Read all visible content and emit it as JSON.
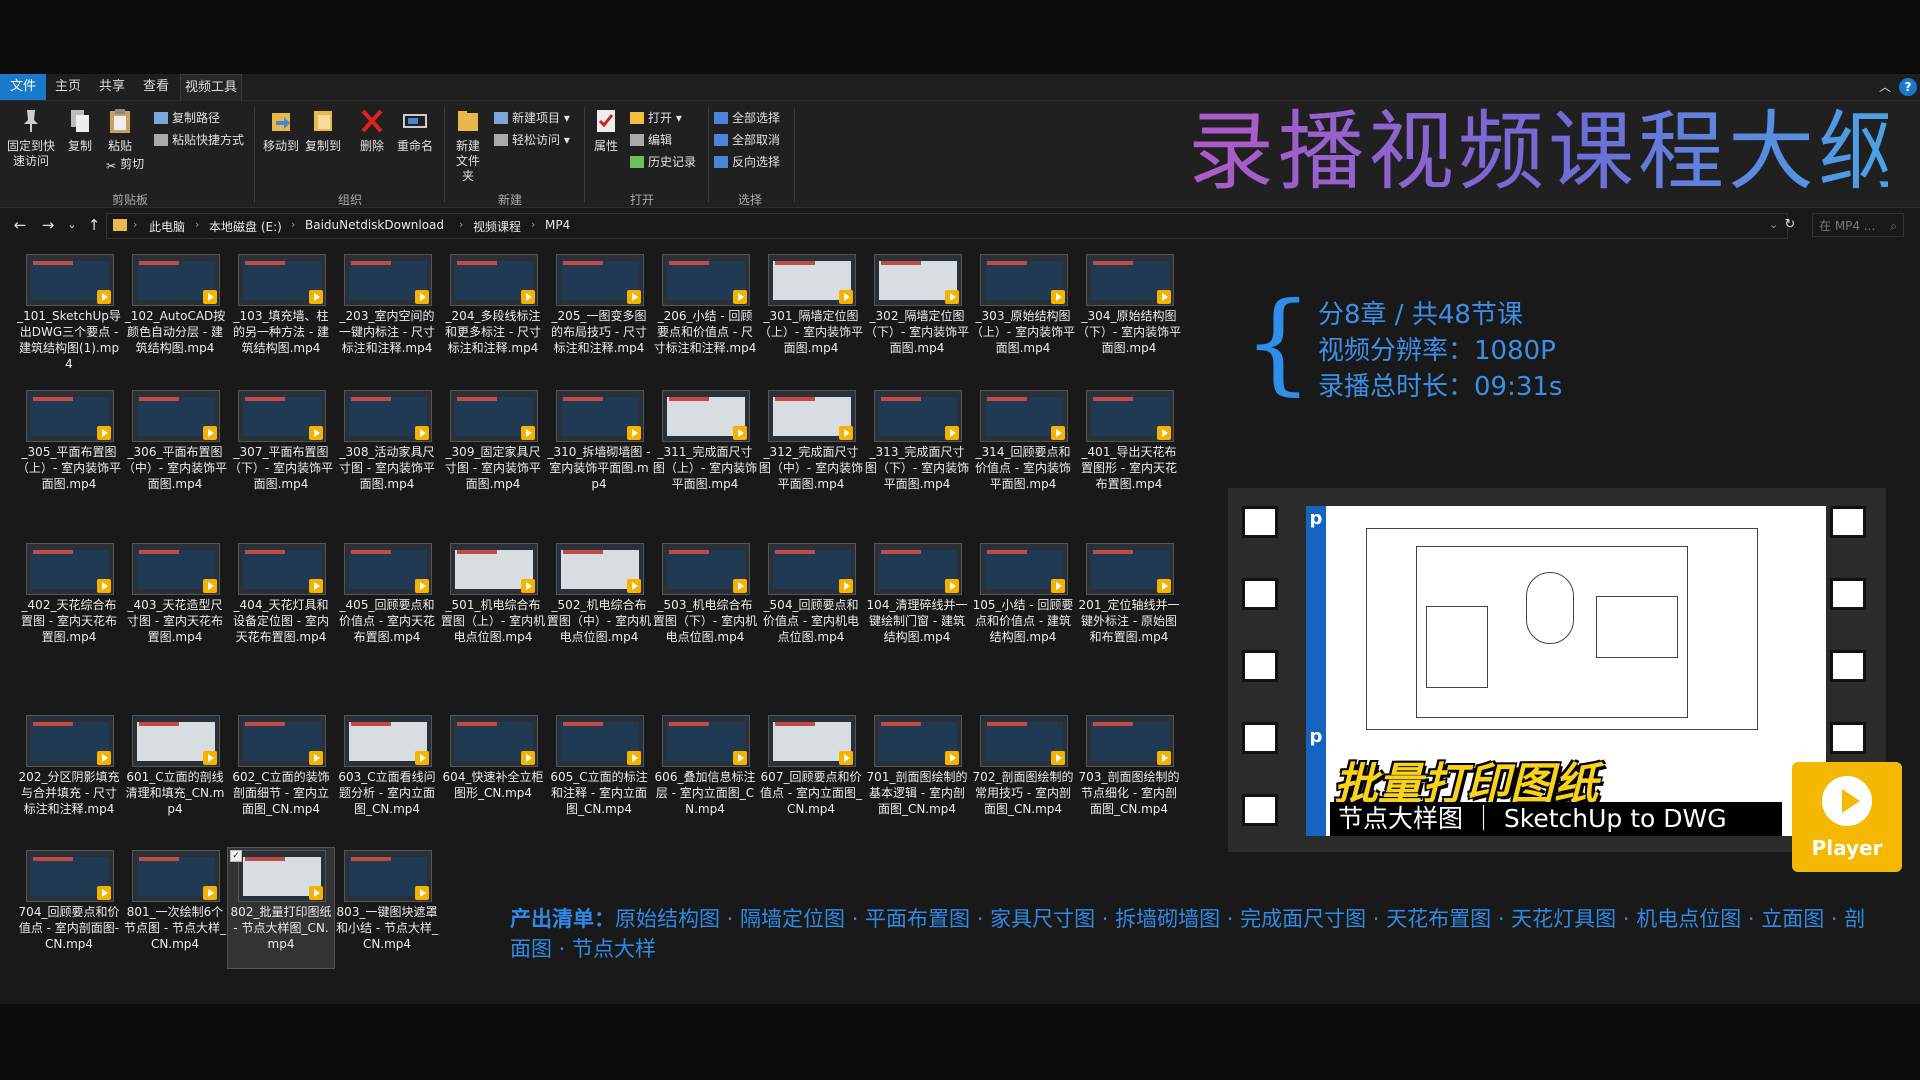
{
  "tabs": {
    "file": "文件",
    "home": "主页",
    "share": "共享",
    "view": "查看",
    "video_tools": "视频工具"
  },
  "ribbon": {
    "pin": "固定到快速访问",
    "copy": "复制",
    "paste": "粘贴",
    "copy_path": "复制路径",
    "paste_shortcut": "粘贴快捷方式",
    "cut": "剪切",
    "move_to": "移动到",
    "copy_to": "复制到",
    "delete": "删除",
    "rename": "重命名",
    "new_folder": "新建文件夹",
    "new_item": "新建项目",
    "easy_access": "轻松访问",
    "properties": "属性",
    "open": "打开",
    "edit": "编辑",
    "history": "历史记录",
    "select_all": "全部选择",
    "select_none": "全部取消",
    "invert": "反向选择",
    "groups": {
      "clipboard": "剪贴板",
      "organize": "组织",
      "new": "新建",
      "open": "打开",
      "select": "选择"
    }
  },
  "address": {
    "crumbs": [
      "此电脑",
      "本地磁盘 (E:)",
      "BaiduNetdiskDownload",
      "视频课程",
      "MP4"
    ],
    "search_placeholder": "在 MP4 ..."
  },
  "files": [
    "_101_SketchUp导出DWG三个要点 - 建筑结构图(1).mp4",
    "_102_AutoCAD按颜色自动分层 - 建筑结构图.mp4",
    "_103_填充墙、柱的另一种方法 - 建筑结构图.mp4",
    "_203_室内空间的一键内标注 - 尺寸标注和注释.mp4",
    "_204_多段线标注和更多标注 - 尺寸标注和注释.mp4",
    "_205_一图变多图的布局技巧 - 尺寸标注和注释.mp4",
    "_206_小结 - 回顾要点和价值点 - 尺寸标注和注释.mp4",
    "_301_隔墙定位图（上）- 室内装饰平面图.mp4",
    "_302_隔墙定位图（下）- 室内装饰平面图.mp4",
    "_303_原始结构图（上）- 室内装饰平面图.mp4",
    "_304_原始结构图（下）- 室内装饰平面图.mp4",
    "_305_平面布置图（上）- 室内装饰平面图.mp4",
    "_306_平面布置图（中）- 室内装饰平面图.mp4",
    "_307_平面布置图（下）- 室内装饰平面图.mp4",
    "_308_活动家具尺寸图 - 室内装饰平面图.mp4",
    "_309_固定家具尺寸图 - 室内装饰平面图.mp4",
    "_310_拆墙砌墙图 - 室内装饰平面图.mp4",
    "_311_完成面尺寸图（上）- 室内装饰平面图.mp4",
    "_312_完成面尺寸图（中）- 室内装饰平面图.mp4",
    "_313_完成面尺寸图（下）- 室内装饰平面图.mp4",
    "_314_回顾要点和价值点 - 室内装饰平面图.mp4",
    "_401_导出天花布置图形 - 室内天花布置图.mp4",
    "_402_天花综合布置图 - 室内天花布置图.mp4",
    "_403_天花造型尺寸图 - 室内天花布置图.mp4",
    "_404_天花灯具和设备定位图 - 室内天花布置图.mp4",
    "_405_回顾要点和价值点 - 室内天花布置图.mp4",
    "_501_机电综合布置图（上）- 室内机电点位图.mp4",
    "_502_机电综合布置图（中）- 室内机电点位图.mp4",
    "_503_机电综合布置图（下）- 室内机电点位图.mp4",
    "_504_回顾要点和价值点 - 室内机电点位图.mp4",
    "104_清理碎线并一键绘制门窗 - 建筑结构图.mp4",
    "105_小结 - 回顾要点和价值点 - 建筑结构图.mp4",
    "201_定位轴线并一键外标注 - 原始图和布置图.mp4",
    "202_分区阴影填充与合并填充 - 尺寸标注和注释.mp4",
    "601_C立面的剖线清理和填充_CN.mp4",
    "602_C立面的装饰剖面细节 - 室内立面图_CN.mp4",
    "603_C立面看线问题分析 - 室内立面图_CN.mp4",
    "604_快速补全立柜图形_CN.mp4",
    "605_C立面的标注和注释 - 室内立面图_CN.mp4",
    "606_叠加信息标注层 - 室内立面图_CN.mp4",
    "607_回顾要点和价值点 - 室内立面图_CN.mp4",
    "701_剖面图绘制的基本逻辑 - 室内剖面图_CN.mp4",
    "702_剖面图绘制的常用技巧 - 室内剖面图_CN.mp4",
    "703_剖面图绘制的节点细化 - 室内剖面图_CN.mp4",
    "704_回顾要点和价值点 - 室内剖面图-CN.mp4",
    "801_一次绘制6个节点图 - 节点大样_CN.mp4",
    "802_批量打印图纸 - 节点大样图_CN.mp4",
    "803_一键图块遮罩和小结 - 节点大样_CN.mp4"
  ],
  "selected_index": 46,
  "overlay": {
    "title": "录播视频课程大纲",
    "stats": [
      "分8章 / 共48节课",
      "视频分辨率：1080P",
      "录播总时长：09:31s"
    ],
    "caption_main": "批量打印图纸",
    "caption_sub": "节点大样图 ｜ SketchUp to DWG",
    "frame_letter_top": "p",
    "frame_letter_mid": "p",
    "player_label": "Player",
    "outputs_label": "产出清单：",
    "outputs_text": "原始结构图 · 隔墙定位图 · 平面布置图 · 家具尺寸图 · 拆墙砌墙图 · 完成面尺寸图 · 天花布置图 · 天花灯具图 · 机电点位图 · 立面图 · 剖面图 · 节点大样"
  },
  "colors": {
    "accent": "#1979ca",
    "overlay_blue": "#2e8ae6",
    "player": "#f5b800",
    "caption_yellow": "#f8d21b"
  }
}
